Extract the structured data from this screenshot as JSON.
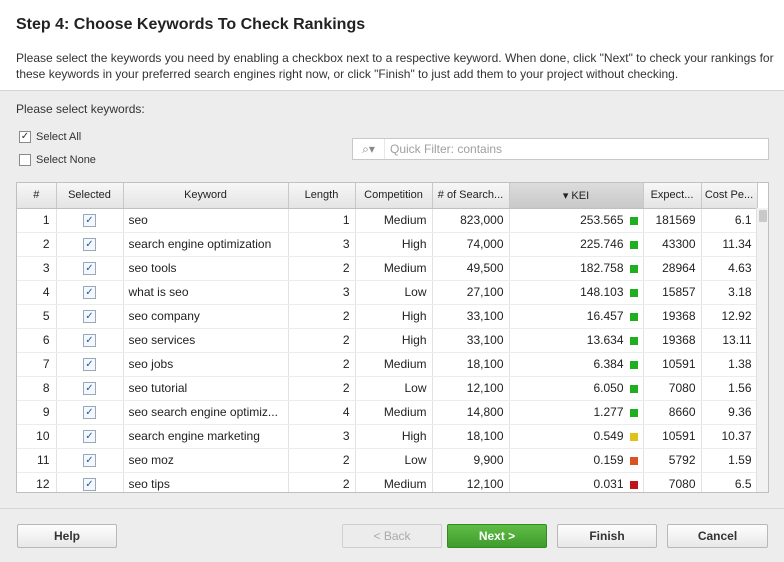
{
  "header": {
    "title": "Step 4: Choose Keywords To Check Rankings",
    "description": "Please select the keywords you need by enabling a checkbox next to a respective keyword. When done, click \"Next\" to check your rankings for these keywords in your preferred search engines right now, or click \"Finish\" to just add them to your project without checking."
  },
  "select": {
    "label": "Please select keywords:",
    "all_label": "Select All",
    "none_label": "Select None"
  },
  "filter": {
    "placeholder": "Quick Filter: contains",
    "icon": "search-icon"
  },
  "table": {
    "columns": [
      "#",
      "Selected",
      "Keyword",
      "Length",
      "Competition",
      "# of Search...",
      "KEI",
      "Expect...",
      "Cost Pe..."
    ],
    "sorted_column": "KEI",
    "sort_indicator": "▾",
    "rows": [
      {
        "idx": "1",
        "keyword": "seo",
        "length": "1",
        "competition": "Medium",
        "searches": "823,000",
        "kei": "253.565",
        "kei_color": "#1fae1f",
        "expected": "181569",
        "cost": "6.1"
      },
      {
        "idx": "2",
        "keyword": "search engine optimization",
        "length": "3",
        "competition": "High",
        "searches": "74,000",
        "kei": "225.746",
        "kei_color": "#1fae1f",
        "expected": "43300",
        "cost": "11.34"
      },
      {
        "idx": "3",
        "keyword": "seo tools",
        "length": "2",
        "competition": "Medium",
        "searches": "49,500",
        "kei": "182.758",
        "kei_color": "#1fae1f",
        "expected": "28964",
        "cost": "4.63"
      },
      {
        "idx": "4",
        "keyword": "what is seo",
        "length": "3",
        "competition": "Low",
        "searches": "27,100",
        "kei": "148.103",
        "kei_color": "#1fae1f",
        "expected": "15857",
        "cost": "3.18"
      },
      {
        "idx": "5",
        "keyword": "seo company",
        "length": "2",
        "competition": "High",
        "searches": "33,100",
        "kei": "16.457",
        "kei_color": "#1fae1f",
        "expected": "19368",
        "cost": "12.92"
      },
      {
        "idx": "6",
        "keyword": "seo services",
        "length": "2",
        "competition": "High",
        "searches": "33,100",
        "kei": "13.634",
        "kei_color": "#1fae1f",
        "expected": "19368",
        "cost": "13.11"
      },
      {
        "idx": "7",
        "keyword": "seo jobs",
        "length": "2",
        "competition": "Medium",
        "searches": "18,100",
        "kei": "6.384",
        "kei_color": "#1fae1f",
        "expected": "10591",
        "cost": "1.38"
      },
      {
        "idx": "8",
        "keyword": "seo tutorial",
        "length": "2",
        "competition": "Low",
        "searches": "12,100",
        "kei": "6.050",
        "kei_color": "#1fae1f",
        "expected": "7080",
        "cost": "1.56"
      },
      {
        "idx": "9",
        "keyword": "seo search engine optimiz...",
        "length": "4",
        "competition": "Medium",
        "searches": "14,800",
        "kei": "1.277",
        "kei_color": "#1fae1f",
        "expected": "8660",
        "cost": "9.36"
      },
      {
        "idx": "10",
        "keyword": "search engine marketing",
        "length": "3",
        "competition": "High",
        "searches": "18,100",
        "kei": "0.549",
        "kei_color": "#e0c21a",
        "expected": "10591",
        "cost": "10.37"
      },
      {
        "idx": "11",
        "keyword": "seo moz",
        "length": "2",
        "competition": "Low",
        "searches": "9,900",
        "kei": "0.159",
        "kei_color": "#d9541e",
        "expected": "5792",
        "cost": "1.59"
      },
      {
        "idx": "12",
        "keyword": "seo tips",
        "length": "2",
        "competition": "Medium",
        "searches": "12,100",
        "kei": "0.031",
        "kei_color": "#c0141a",
        "expected": "7080",
        "cost": "6.5"
      }
    ]
  },
  "buttons": {
    "help": "Help",
    "back": "< Back",
    "next": "Next >",
    "finish": "Finish",
    "cancel": "Cancel"
  }
}
